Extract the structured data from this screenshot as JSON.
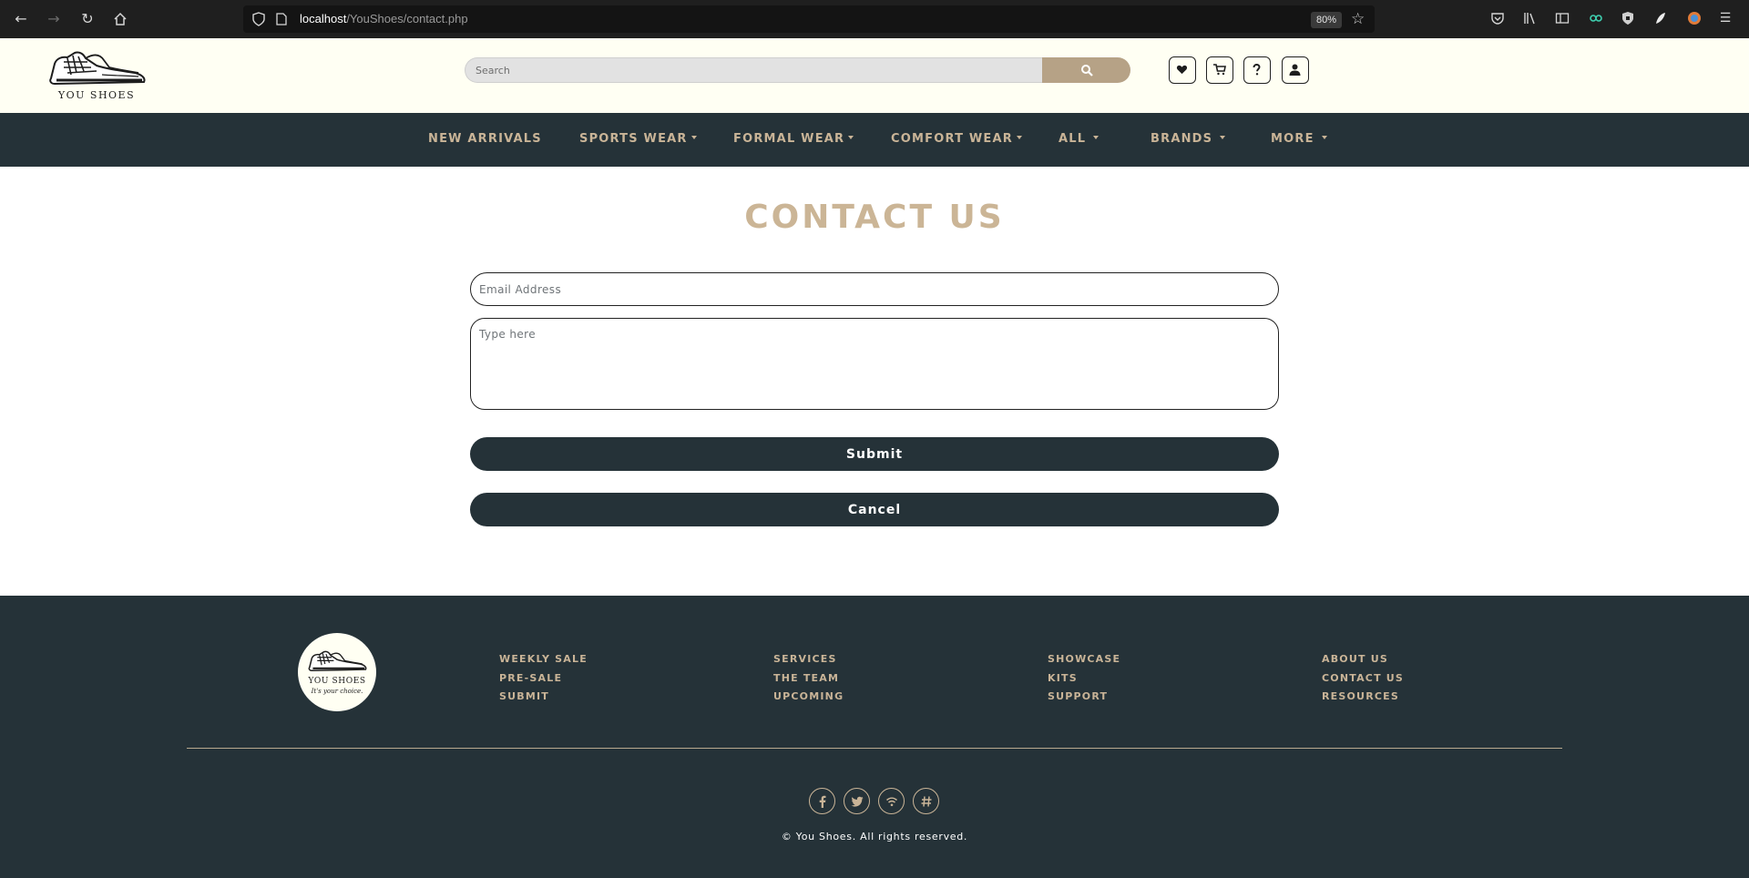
{
  "browser": {
    "url_host": "localhost",
    "url_path": "/YouShoes/contact.php",
    "zoom": "80%",
    "toolbar_icons": [
      "back-icon",
      "forward-icon",
      "reload-icon",
      "home-icon",
      "pocket-icon",
      "library-icon",
      "sidebar-icon",
      "extension-icon",
      "shield-extension-icon",
      "feather-extension-icon",
      "profile-icon",
      "menu-icon"
    ]
  },
  "header": {
    "logo_text": "YOU SHOES",
    "search_placeholder": "Search",
    "icons": [
      "heart-icon",
      "cart-icon",
      "help-icon",
      "user-icon"
    ]
  },
  "nav": {
    "items": [
      {
        "label": "NEW ARRIVALS",
        "dropdown": false
      },
      {
        "label": "SPORTS WEAR",
        "dropdown": true
      },
      {
        "label": "FORMAL WEAR",
        "dropdown": true
      },
      {
        "label": "COMFORT WEAR",
        "dropdown": true
      },
      {
        "label": "ALL",
        "dropdown": true
      },
      {
        "label": "BRANDS",
        "dropdown": true
      },
      {
        "label": "MORE",
        "dropdown": true
      }
    ]
  },
  "contact": {
    "title": "CONTACT US",
    "email_placeholder": "Email Address",
    "message_placeholder": "Type here",
    "submit_label": "Submit",
    "cancel_label": "Cancel"
  },
  "footer": {
    "logo_title": "YOU SHOES",
    "logo_tagline": "It's your choice.",
    "columns": [
      [
        "WEEKLY SALE",
        "PRE-SALE",
        "SUBMIT"
      ],
      [
        "SERVICES",
        "THE TEAM",
        "UPCOMING"
      ],
      [
        "SHOWCASE",
        "KITS",
        "SUPPORT"
      ],
      [
        "ABOUT US",
        "CONTACT US",
        "RESOURCES"
      ]
    ],
    "social_icons": [
      "facebook-icon",
      "twitter-icon",
      "rss-icon",
      "hashtag-icon"
    ],
    "copyright": "© You Shoes. All rights reserved."
  },
  "colors": {
    "dark": "#253238",
    "accent": "#c9b497",
    "header_bg": "#fffff3",
    "search_button": "#b6a286"
  }
}
